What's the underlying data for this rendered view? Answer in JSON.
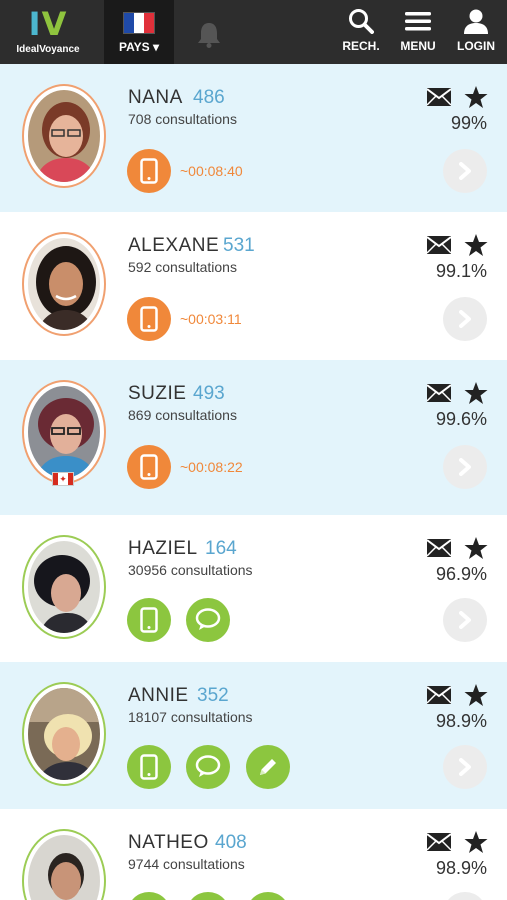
{
  "header": {
    "logo_mark_i": "I",
    "logo_mark_v": "V",
    "logo_text": "IdealVoyance",
    "pays_label": "PAYS ▾",
    "rech_label": "RECH.",
    "menu_label": "MENU",
    "login_label": "LOGIN"
  },
  "colors": {
    "accent_orange": "#f0883a",
    "accent_green": "#8cc63f",
    "score_blue": "#5aa6cf",
    "row_blue": "#e3f4fb",
    "header_bg": "#2d2d2d"
  },
  "icons": [
    "search-icon",
    "menu-icon",
    "user-icon",
    "bell-icon",
    "phone-icon",
    "chat-icon",
    "pencil-icon",
    "mail-icon",
    "star-icon",
    "chevron-right-icon"
  ],
  "psychics": [
    {
      "name": "NANA",
      "score": "486",
      "consultations": "708 consultations",
      "rating": "99%",
      "timer": "~00:08:40"
    },
    {
      "name": "ALEXANE",
      "score": "531",
      "consultations": "592 consultations",
      "rating": "99.1%",
      "timer": "~00:03:11"
    },
    {
      "name": "SUZIE",
      "score": "493",
      "consultations": "869 consultations",
      "rating": "99.6%",
      "timer": "~00:08:22"
    },
    {
      "name": "HAZIEL",
      "score": "164",
      "consultations": "30956 consultations",
      "rating": "96.9%"
    },
    {
      "name": "ANNIE",
      "score": "352",
      "consultations": "18107 consultations",
      "rating": "98.9%"
    },
    {
      "name": "NATHEO",
      "score": "408",
      "consultations": "9744 consultations",
      "rating": "98.9%"
    }
  ]
}
